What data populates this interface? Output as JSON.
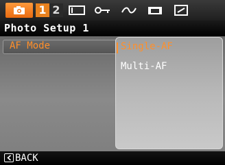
{
  "tabs": {
    "camera_icon": "camera-icon",
    "page_1": "1",
    "page_2": "2",
    "icons": [
      "video-icon",
      "key-icon",
      "playback-icon",
      "print-icon",
      "setup-icon"
    ]
  },
  "menu": {
    "title": "Photo Setup 1",
    "selected_item": "AF Mode",
    "options": [
      "Single-AF",
      "Multi-AF"
    ],
    "selected_option": "Single-AF"
  },
  "footer": {
    "back_label": "BACK",
    "back_icon": "chevron-left-icon"
  },
  "colors": {
    "accent": "#e8811e",
    "highlight_text": "#ff8f2a"
  }
}
